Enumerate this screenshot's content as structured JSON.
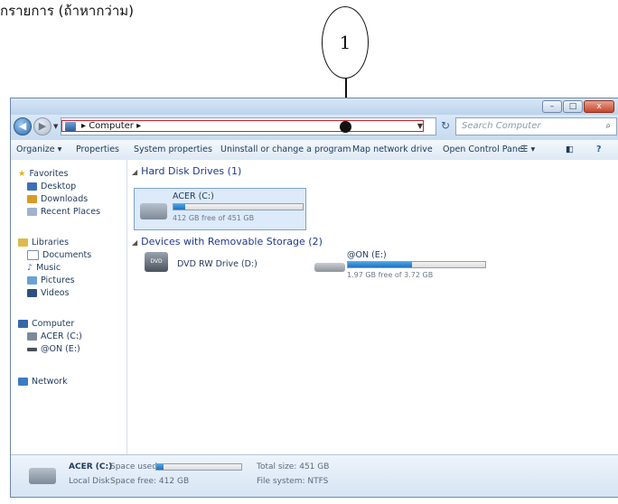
{
  "caption": "กรายการ (ถ้าหากว่าม)",
  "callout": {
    "number": "1"
  },
  "window": {
    "controls": {
      "minimize": "–",
      "maximize": "□",
      "close": "x"
    },
    "nav": {
      "back": "◀",
      "forward": "▶"
    },
    "address": {
      "crumb": "▸ Computer ▸",
      "refresh_glyph": "↻"
    },
    "search": {
      "placeholder": "Search Computer"
    },
    "toolbar": {
      "organize": "Organize ▾",
      "properties": "Properties",
      "system_properties": "System properties",
      "uninstall": "Uninstall or change a program",
      "map_drive": "Map network drive",
      "control_panel": "Open Control Panel",
      "help": "?"
    },
    "navpane": {
      "favorites": "Favorites",
      "desktop": "Desktop",
      "downloads": "Downloads",
      "recent": "Recent Places",
      "libraries": "Libraries",
      "documents": "Documents",
      "music": "Music",
      "pictures": "Pictures",
      "videos": "Videos",
      "computer": "Computer",
      "acer": "ACER (C:)",
      "eon": "@ON (E:)",
      "network": "Network"
    },
    "main": {
      "hdd_header": "Hard Disk Drives (1)",
      "removable_header": "Devices with Removable Storage (2)",
      "acer_name": "ACER (C:)",
      "acer_free": "412 GB free of 451 GB",
      "acer_used_fraction": 0.09,
      "dvd_name": "DVD RW Drive (D:)",
      "eon_name": "@ON (E:)",
      "eon_free": "1.97 GB free of 3.72 GB",
      "eon_used_fraction": 0.47,
      "dvd_badge": "DVD"
    },
    "status": {
      "drive": "ACER (C:)",
      "type": "Local Disk",
      "space_used_label": "Space used:",
      "space_free": "Space free: 412 GB",
      "total_size": "Total size: 451 GB",
      "filesystem": "File system: NTFS",
      "used_fraction": 0.09
    }
  }
}
